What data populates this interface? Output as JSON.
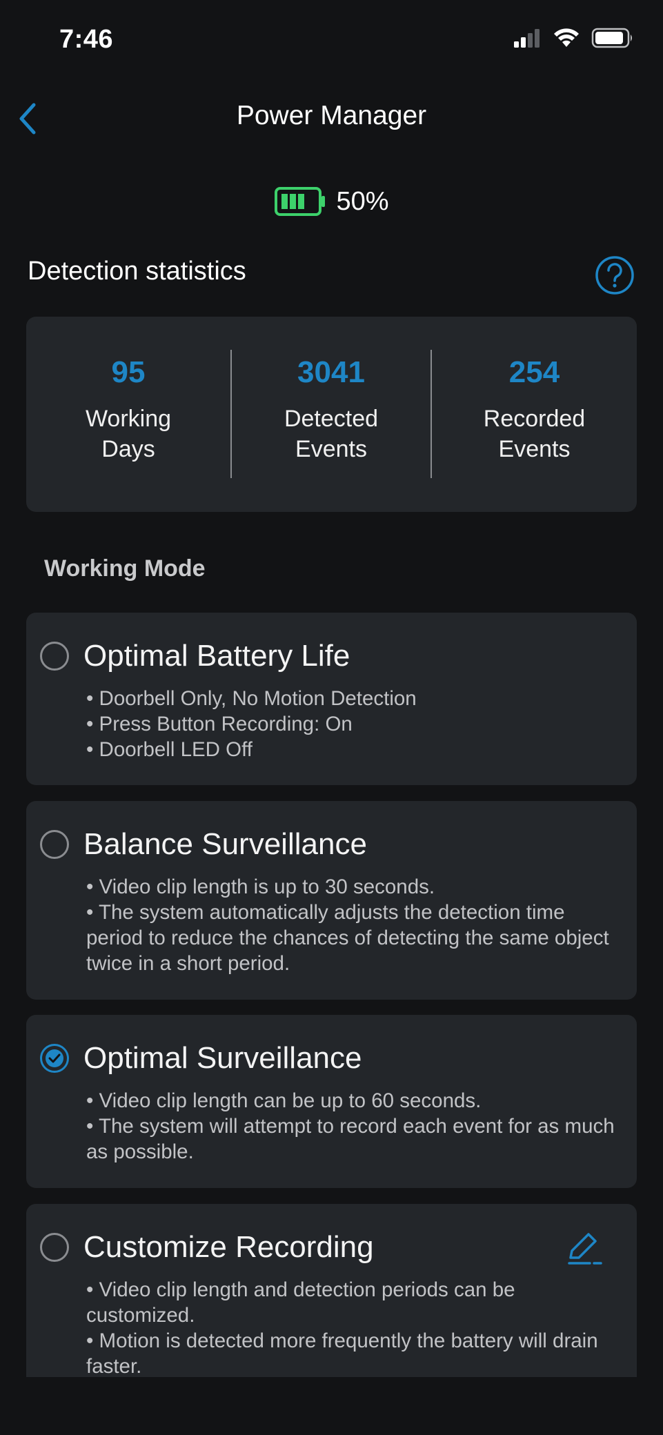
{
  "status_bar": {
    "time": "7:46"
  },
  "header": {
    "title": "Power Manager"
  },
  "battery": {
    "percent_label": "50%",
    "level": 0.5,
    "color": "#3dd16b"
  },
  "detection": {
    "title": "Detection statistics",
    "stats": [
      {
        "value": "95",
        "label_line1": "Working",
        "label_line2": "Days"
      },
      {
        "value": "3041",
        "label_line1": "Detected",
        "label_line2": "Events"
      },
      {
        "value": "254",
        "label_line1": "Recorded",
        "label_line2": "Events"
      }
    ]
  },
  "working_mode": {
    "label": "Working Mode",
    "selected": "Optimal Surveillance",
    "modes": [
      {
        "title": "Optimal Battery Life",
        "lines": [
          "• Doorbell Only, No Motion Detection",
          "• Press Button Recording: On",
          "• Doorbell LED Off"
        ]
      },
      {
        "title": "Balance Surveillance",
        "lines": [
          "• Video clip length is up to 30 seconds.",
          "• The system automatically adjusts the detection time period to reduce the chances of detecting the same object twice in a short period."
        ]
      },
      {
        "title": "Optimal Surveillance",
        "lines": [
          "• Video clip length can be up to 60 seconds.",
          "• The system will attempt to record each event for as much as possible."
        ]
      },
      {
        "title": "Customize Recording",
        "lines": [
          "• Video clip length and detection periods can be customized.",
          "• Motion is detected more frequently the battery will drain faster."
        ]
      }
    ]
  },
  "colors": {
    "accent": "#1e86c6",
    "background": "#121315",
    "card": "#23262a"
  }
}
